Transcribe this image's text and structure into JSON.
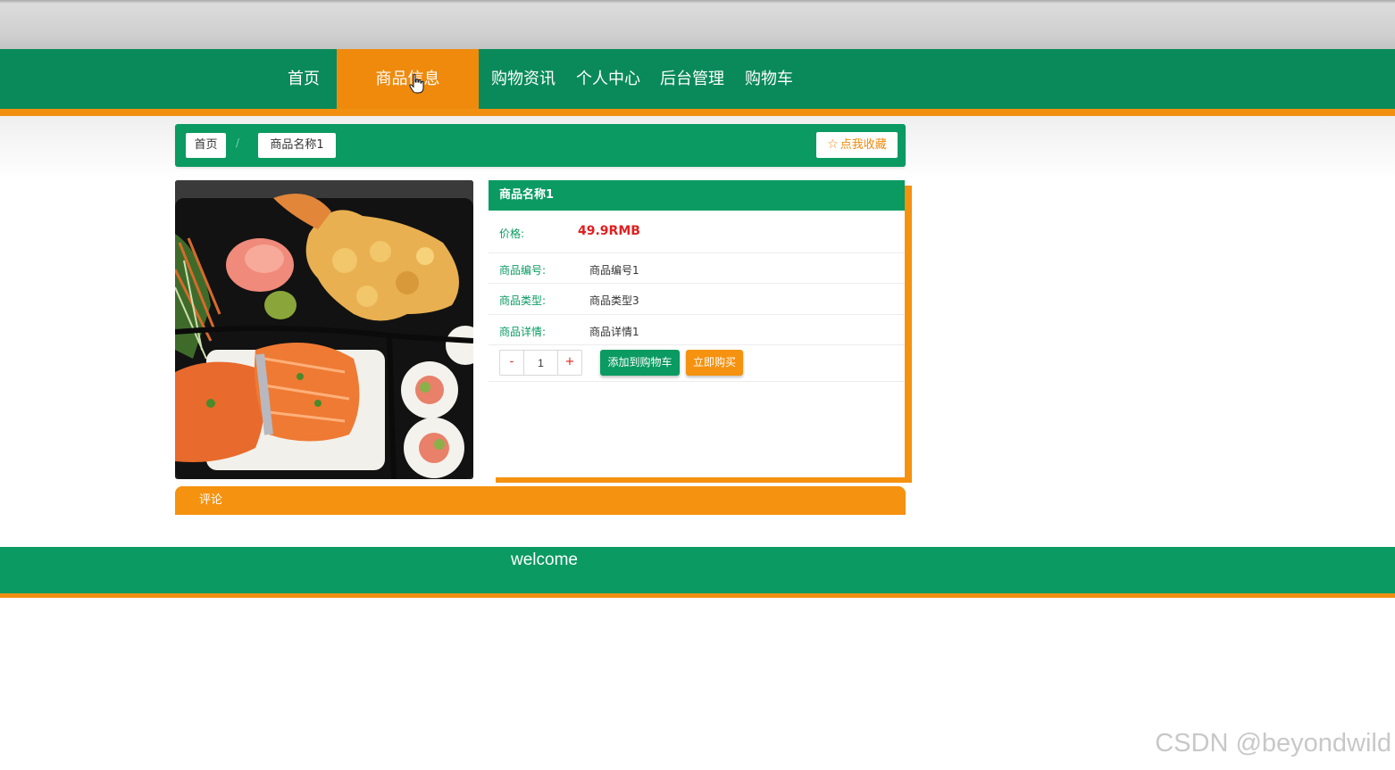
{
  "nav": {
    "items": [
      {
        "label": "首页"
      },
      {
        "label": "商品信息"
      },
      {
        "label": "购物资讯"
      },
      {
        "label": "个人中心"
      },
      {
        "label": "后台管理"
      },
      {
        "label": "购物车"
      }
    ],
    "active_index": 1
  },
  "breadcrumb": {
    "home": "首页",
    "separator": "/",
    "current": "商品名称1",
    "favorite_label": "点我收藏",
    "favorite_icon": "star-outline-icon"
  },
  "product": {
    "image_alt": "bento box with salmon, tempura shrimp, sushi rolls",
    "title": "商品名称1",
    "price_label": "价格:",
    "price_value": "49.9RMB",
    "fields": [
      {
        "label": "商品编号:",
        "value": "商品编号1"
      },
      {
        "label": "商品类型:",
        "value": "商品类型3"
      },
      {
        "label": "商品详情:",
        "value": "商品详情1"
      }
    ],
    "quantity": "1",
    "minus_label": "-",
    "plus_label": "+",
    "add_to_cart_label": "添加到购物车",
    "buy_now_label": "立即购买"
  },
  "comments": {
    "label": "评论"
  },
  "footer": {
    "text": "welcome"
  },
  "watermark": "CSDN @beyondwild",
  "colors": {
    "primary_green": "#0a9a62",
    "accent_orange": "#f5920f",
    "price_red": "#e02020"
  }
}
